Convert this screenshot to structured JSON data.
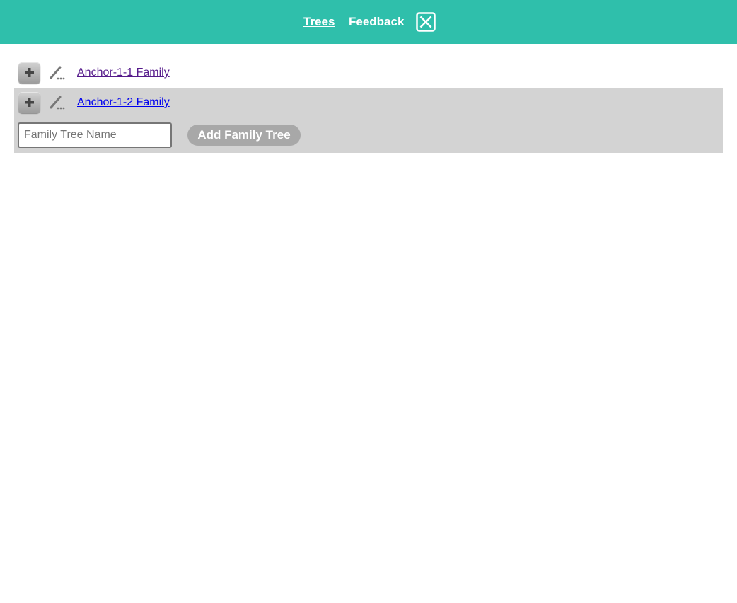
{
  "header": {
    "nav_trees": "Trees",
    "nav_feedback": "Feedback",
    "close_icon": "close-box-icon",
    "bg_color": "#2fbfab"
  },
  "trees": [
    {
      "name": "Anchor-1-1 Family",
      "visited": true
    },
    {
      "name": "Anchor-1-2 Family",
      "visited": false
    }
  ],
  "add_form": {
    "input_value": "",
    "input_placeholder": "Family Tree Name",
    "button_label": "Add Family Tree"
  },
  "icons": {
    "add": "plus-icon",
    "edit": "pencil-edit-icon"
  }
}
